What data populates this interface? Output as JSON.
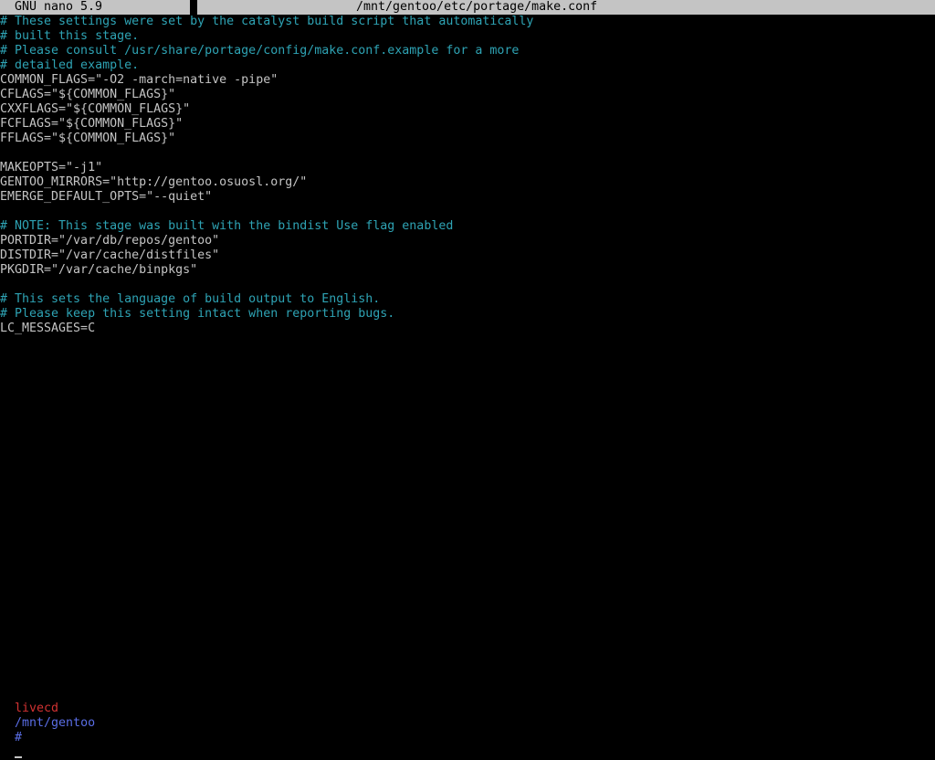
{
  "titlebar": {
    "app_name": "GNU nano 5.9",
    "file_path": "/mnt/gentoo/etc/portage/make.conf"
  },
  "editor": {
    "lines": [
      {
        "text": "# These settings were set by the catalyst build script that automatically",
        "kind": "comment"
      },
      {
        "text": "# built this stage.",
        "kind": "comment"
      },
      {
        "text": "# Please consult /usr/share/portage/config/make.conf.example for a more",
        "kind": "comment"
      },
      {
        "text": "# detailed example.",
        "kind": "comment"
      },
      {
        "text": "COMMON_FLAGS=\"-O2 -march=native -pipe\"",
        "kind": "code"
      },
      {
        "text": "CFLAGS=\"${COMMON_FLAGS}\"",
        "kind": "code"
      },
      {
        "text": "CXXFLAGS=\"${COMMON_FLAGS}\"",
        "kind": "code"
      },
      {
        "text": "FCFLAGS=\"${COMMON_FLAGS}\"",
        "kind": "code"
      },
      {
        "text": "FFLAGS=\"${COMMON_FLAGS}\"",
        "kind": "code"
      },
      {
        "text": "",
        "kind": "code"
      },
      {
        "text": "MAKEOPTS=\"-j1\"",
        "kind": "code"
      },
      {
        "text": "GENTOO_MIRRORS=\"http://gentoo.osuosl.org/\"",
        "kind": "code"
      },
      {
        "text": "EMERGE_DEFAULT_OPTS=\"--quiet\"",
        "kind": "code"
      },
      {
        "text": "",
        "kind": "code"
      },
      {
        "text": "# NOTE: This stage was built with the bindist Use flag enabled",
        "kind": "comment"
      },
      {
        "text": "PORTDIR=\"/var/db/repos/gentoo\"",
        "kind": "code"
      },
      {
        "text": "DISTDIR=\"/var/cache/distfiles\"",
        "kind": "code"
      },
      {
        "text": "PKGDIR=\"/var/cache/binpkgs\"",
        "kind": "code"
      },
      {
        "text": "",
        "kind": "code"
      },
      {
        "text": "# This sets the language of build output to English.",
        "kind": "comment"
      },
      {
        "text": "# Please keep this setting intact when reporting bugs.",
        "kind": "comment"
      },
      {
        "text": "LC_MESSAGES=C",
        "kind": "code"
      }
    ]
  },
  "prompt": {
    "host": "livecd",
    "cwd": "/mnt/gentoo",
    "symbol": "#"
  },
  "colors": {
    "background": "#000000",
    "text": "#c4c4c4",
    "comment": "#2ea3b4",
    "titlebar_bg": "#c4c4c4",
    "prompt_host": "#d23232",
    "prompt_path": "#5a6ee6"
  }
}
